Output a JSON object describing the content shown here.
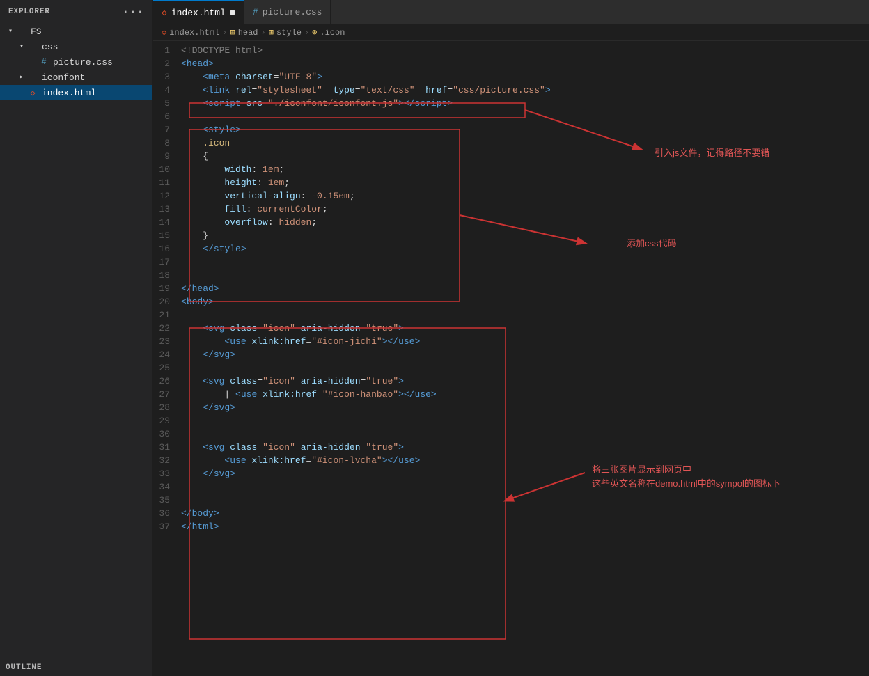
{
  "sidebar": {
    "header": "Explorer",
    "dots": "···",
    "fs_label": "FS",
    "css_folder": "css",
    "picture_css": "picture.css",
    "iconfont_folder": "iconfont",
    "index_html": "index.html",
    "outline_label": "Outline"
  },
  "tabs": [
    {
      "label": "index.html",
      "active": true,
      "modified": true,
      "type": "html"
    },
    {
      "label": "picture.css",
      "active": false,
      "modified": false,
      "type": "css"
    }
  ],
  "breadcrumb": [
    "index.html",
    "head",
    "style",
    ".icon"
  ],
  "lines": [
    {
      "num": 1,
      "tokens": [
        {
          "t": "<!DOCTYPE html>",
          "c": "c-doctype"
        }
      ]
    },
    {
      "num": 2,
      "tokens": [
        {
          "t": "<",
          "c": "c-tag"
        },
        {
          "t": "head",
          "c": "c-tag"
        },
        {
          "t": ">",
          "c": "c-tag"
        }
      ]
    },
    {
      "num": 3,
      "tokens": [
        {
          "t": "    ",
          "c": "c-text"
        },
        {
          "t": "<",
          "c": "c-tag"
        },
        {
          "t": "meta",
          "c": "c-tag"
        },
        {
          "t": " ",
          "c": "c-text"
        },
        {
          "t": "charset",
          "c": "c-attr"
        },
        {
          "t": "=",
          "c": "c-punc"
        },
        {
          "t": "\"UTF-8\"",
          "c": "c-val"
        },
        {
          "t": ">",
          "c": "c-tag"
        }
      ]
    },
    {
      "num": 4,
      "tokens": [
        {
          "t": "    ",
          "c": "c-text"
        },
        {
          "t": "<",
          "c": "c-tag"
        },
        {
          "t": "link",
          "c": "c-tag"
        },
        {
          "t": " ",
          "c": "c-text"
        },
        {
          "t": "rel",
          "c": "c-attr"
        },
        {
          "t": "=",
          "c": "c-punc"
        },
        {
          "t": "\"stylesheet\"",
          "c": "c-val"
        },
        {
          "t": "  ",
          "c": "c-text"
        },
        {
          "t": "type",
          "c": "c-attr"
        },
        {
          "t": "=",
          "c": "c-punc"
        },
        {
          "t": "\"text/css\"",
          "c": "c-val"
        },
        {
          "t": "  ",
          "c": "c-text"
        },
        {
          "t": "href",
          "c": "c-attr"
        },
        {
          "t": "=",
          "c": "c-punc"
        },
        {
          "t": "\"css/picture.css\"",
          "c": "c-val"
        },
        {
          "t": ">",
          "c": "c-tag"
        }
      ]
    },
    {
      "num": 5,
      "tokens": [
        {
          "t": "    ",
          "c": "c-text"
        },
        {
          "t": "<",
          "c": "c-tag"
        },
        {
          "t": "script",
          "c": "c-tag"
        },
        {
          "t": " ",
          "c": "c-text"
        },
        {
          "t": "src",
          "c": "c-attr"
        },
        {
          "t": "=",
          "c": "c-punc"
        },
        {
          "t": "\"./iconfont/iconfont.js\"",
          "c": "c-val"
        },
        {
          "t": "></",
          "c": "c-tag"
        },
        {
          "t": "script",
          "c": "c-tag"
        },
        {
          "t": ">",
          "c": "c-tag"
        }
      ]
    },
    {
      "num": 6,
      "tokens": []
    },
    {
      "num": 7,
      "tokens": [
        {
          "t": "    ",
          "c": "c-text"
        },
        {
          "t": "<",
          "c": "c-tag"
        },
        {
          "t": "style",
          "c": "c-tag"
        },
        {
          "t": ">",
          "c": "c-tag"
        }
      ]
    },
    {
      "num": 8,
      "tokens": [
        {
          "t": "    .icon",
          "c": "c-selector"
        }
      ]
    },
    {
      "num": 9,
      "tokens": [
        {
          "t": "    {",
          "c": "c-brace"
        }
      ]
    },
    {
      "num": 10,
      "tokens": [
        {
          "t": "        ",
          "c": "c-text"
        },
        {
          "t": "width",
          "c": "c-css-prop"
        },
        {
          "t": ": ",
          "c": "c-text"
        },
        {
          "t": "1em",
          "c": "c-css-val"
        },
        {
          "t": ";",
          "c": "c-text"
        }
      ]
    },
    {
      "num": 11,
      "tokens": [
        {
          "t": "        ",
          "c": "c-text"
        },
        {
          "t": "height",
          "c": "c-css-prop"
        },
        {
          "t": ": ",
          "c": "c-text"
        },
        {
          "t": "1em",
          "c": "c-css-val"
        },
        {
          "t": ";",
          "c": "c-text"
        }
      ]
    },
    {
      "num": 12,
      "tokens": [
        {
          "t": "        ",
          "c": "c-text"
        },
        {
          "t": "vertical-align",
          "c": "c-css-prop"
        },
        {
          "t": ": ",
          "c": "c-text"
        },
        {
          "t": "-0.15em",
          "c": "c-css-val"
        },
        {
          "t": ";",
          "c": "c-text"
        }
      ]
    },
    {
      "num": 13,
      "tokens": [
        {
          "t": "        ",
          "c": "c-text"
        },
        {
          "t": "fill",
          "c": "c-css-prop"
        },
        {
          "t": ": ",
          "c": "c-text"
        },
        {
          "t": "currentColor",
          "c": "c-css-val"
        },
        {
          "t": ";",
          "c": "c-text"
        }
      ]
    },
    {
      "num": 14,
      "tokens": [
        {
          "t": "        ",
          "c": "c-text"
        },
        {
          "t": "overflow",
          "c": "c-css-prop"
        },
        {
          "t": ": ",
          "c": "c-text"
        },
        {
          "t": "hidden",
          "c": "c-css-val"
        },
        {
          "t": ";",
          "c": "c-text"
        }
      ]
    },
    {
      "num": 15,
      "tokens": [
        {
          "t": "    }",
          "c": "c-brace"
        }
      ]
    },
    {
      "num": 16,
      "tokens": [
        {
          "t": "    ",
          "c": "c-text"
        },
        {
          "t": "</",
          "c": "c-tag"
        },
        {
          "t": "style",
          "c": "c-tag"
        },
        {
          "t": ">",
          "c": "c-tag"
        }
      ]
    },
    {
      "num": 17,
      "tokens": []
    },
    {
      "num": 18,
      "tokens": []
    },
    {
      "num": 19,
      "tokens": [
        {
          "t": "</",
          "c": "c-tag"
        },
        {
          "t": "head",
          "c": "c-tag"
        },
        {
          "t": ">",
          "c": "c-tag"
        }
      ]
    },
    {
      "num": 20,
      "tokens": [
        {
          "t": "<",
          "c": "c-tag"
        },
        {
          "t": "body",
          "c": "c-tag"
        },
        {
          "t": ">",
          "c": "c-tag"
        }
      ]
    },
    {
      "num": 21,
      "tokens": []
    },
    {
      "num": 22,
      "tokens": [
        {
          "t": "    ",
          "c": "c-text"
        },
        {
          "t": "<",
          "c": "c-tag"
        },
        {
          "t": "svg",
          "c": "c-tag"
        },
        {
          "t": " ",
          "c": "c-text"
        },
        {
          "t": "class",
          "c": "c-attr"
        },
        {
          "t": "=",
          "c": "c-punc"
        },
        {
          "t": "\"icon\"",
          "c": "c-val"
        },
        {
          "t": " ",
          "c": "c-text"
        },
        {
          "t": "aria-hidden",
          "c": "c-attr"
        },
        {
          "t": "=",
          "c": "c-punc"
        },
        {
          "t": "\"true\"",
          "c": "c-val"
        },
        {
          "t": ">",
          "c": "c-tag"
        }
      ]
    },
    {
      "num": 23,
      "tokens": [
        {
          "t": "        ",
          "c": "c-text"
        },
        {
          "t": "<",
          "c": "c-tag"
        },
        {
          "t": "use",
          "c": "c-tag"
        },
        {
          "t": " ",
          "c": "c-text"
        },
        {
          "t": "xlink:href",
          "c": "c-attr"
        },
        {
          "t": "=",
          "c": "c-punc"
        },
        {
          "t": "\"#icon-jichi\"",
          "c": "c-val"
        },
        {
          "t": "></",
          "c": "c-tag"
        },
        {
          "t": "use",
          "c": "c-tag"
        },
        {
          "t": ">",
          "c": "c-tag"
        }
      ]
    },
    {
      "num": 24,
      "tokens": [
        {
          "t": "    ",
          "c": "c-text"
        },
        {
          "t": "</",
          "c": "c-tag"
        },
        {
          "t": "svg",
          "c": "c-tag"
        },
        {
          "t": ">",
          "c": "c-tag"
        }
      ]
    },
    {
      "num": 25,
      "tokens": []
    },
    {
      "num": 26,
      "tokens": [
        {
          "t": "    ",
          "c": "c-text"
        },
        {
          "t": "<",
          "c": "c-tag"
        },
        {
          "t": "svg",
          "c": "c-tag"
        },
        {
          "t": " ",
          "c": "c-text"
        },
        {
          "t": "class",
          "c": "c-attr"
        },
        {
          "t": "=",
          "c": "c-punc"
        },
        {
          "t": "\"icon\"",
          "c": "c-val"
        },
        {
          "t": " ",
          "c": "c-text"
        },
        {
          "t": "aria-hidden",
          "c": "c-attr"
        },
        {
          "t": "=",
          "c": "c-punc"
        },
        {
          "t": "\"true\"",
          "c": "c-val"
        },
        {
          "t": ">",
          "c": "c-tag"
        }
      ]
    },
    {
      "num": 27,
      "tokens": [
        {
          "t": "        ",
          "c": "c-text"
        },
        {
          "t": "| ",
          "c": "c-text"
        },
        {
          "t": "<",
          "c": "c-tag"
        },
        {
          "t": "use",
          "c": "c-tag"
        },
        {
          "t": " ",
          "c": "c-text"
        },
        {
          "t": "xlink:href",
          "c": "c-attr"
        },
        {
          "t": "=",
          "c": "c-punc"
        },
        {
          "t": "\"#icon-hanbao\"",
          "c": "c-val"
        },
        {
          "t": "></",
          "c": "c-tag"
        },
        {
          "t": "use",
          "c": "c-tag"
        },
        {
          "t": ">",
          "c": "c-tag"
        }
      ]
    },
    {
      "num": 28,
      "tokens": [
        {
          "t": "    ",
          "c": "c-text"
        },
        {
          "t": "</",
          "c": "c-tag"
        },
        {
          "t": "svg",
          "c": "c-tag"
        },
        {
          "t": ">",
          "c": "c-tag"
        }
      ]
    },
    {
      "num": 29,
      "tokens": []
    },
    {
      "num": 30,
      "tokens": []
    },
    {
      "num": 31,
      "tokens": [
        {
          "t": "    ",
          "c": "c-text"
        },
        {
          "t": "<",
          "c": "c-tag"
        },
        {
          "t": "svg",
          "c": "c-tag"
        },
        {
          "t": " ",
          "c": "c-text"
        },
        {
          "t": "class",
          "c": "c-attr"
        },
        {
          "t": "=",
          "c": "c-punc"
        },
        {
          "t": "\"icon\"",
          "c": "c-val"
        },
        {
          "t": " ",
          "c": "c-text"
        },
        {
          "t": "aria-hidden",
          "c": "c-attr"
        },
        {
          "t": "=",
          "c": "c-punc"
        },
        {
          "t": "\"true\"",
          "c": "c-val"
        },
        {
          "t": ">",
          "c": "c-tag"
        }
      ]
    },
    {
      "num": 32,
      "tokens": [
        {
          "t": "        ",
          "c": "c-text"
        },
        {
          "t": "<",
          "c": "c-tag"
        },
        {
          "t": "use",
          "c": "c-tag"
        },
        {
          "t": " ",
          "c": "c-text"
        },
        {
          "t": "xlink:href",
          "c": "c-attr"
        },
        {
          "t": "=",
          "c": "c-punc"
        },
        {
          "t": "\"#icon-lvcha\"",
          "c": "c-val"
        },
        {
          "t": "></",
          "c": "c-tag"
        },
        {
          "t": "use",
          "c": "c-tag"
        },
        {
          "t": ">",
          "c": "c-tag"
        }
      ]
    },
    {
      "num": 33,
      "tokens": [
        {
          "t": "    ",
          "c": "c-text"
        },
        {
          "t": "</",
          "c": "c-tag"
        },
        {
          "t": "svg",
          "c": "c-tag"
        },
        {
          "t": ">",
          "c": "c-tag"
        }
      ]
    },
    {
      "num": 34,
      "tokens": []
    },
    {
      "num": 35,
      "tokens": []
    },
    {
      "num": 36,
      "tokens": [
        {
          "t": "</",
          "c": "c-tag"
        },
        {
          "t": "body",
          "c": "c-tag"
        },
        {
          "t": ">",
          "c": "c-tag"
        }
      ]
    },
    {
      "num": 37,
      "tokens": [
        {
          "t": "</",
          "c": "c-tag"
        },
        {
          "t": "html",
          "c": "c-tag"
        },
        {
          "t": ">",
          "c": "c-tag"
        }
      ]
    }
  ],
  "annotations": {
    "annotation1_text": "引入js文件，记得路径不要错",
    "annotation2_text": "添加css代码",
    "annotation3_text": "将三张图片显示到网页中",
    "annotation3b_text": "这些英文名称在demo.html中的sympol的图标下"
  }
}
